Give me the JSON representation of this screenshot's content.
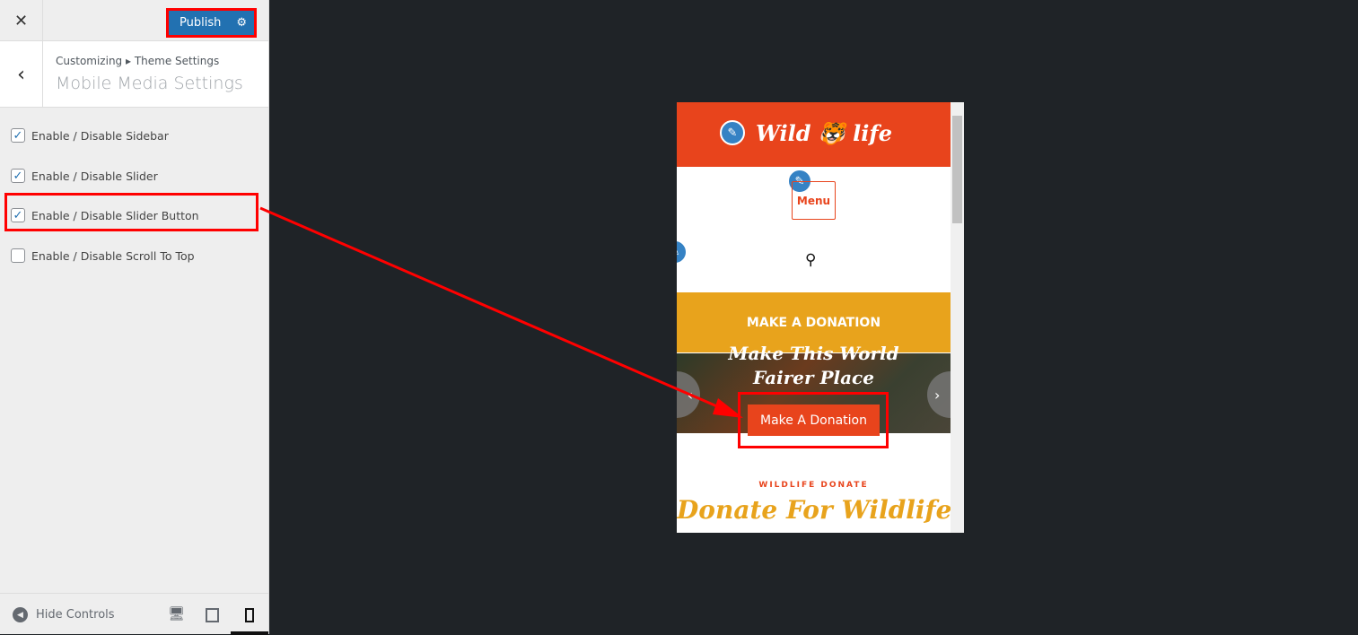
{
  "sidebar": {
    "publish_label": "Publish",
    "breadcrumb": "Customizing ▸ Theme Settings",
    "title": "Mobile Media Settings",
    "options": [
      {
        "label": "Enable / Disable Sidebar",
        "checked": true
      },
      {
        "label": "Enable / Disable Slider",
        "checked": true
      },
      {
        "label": "Enable / Disable Slider Button",
        "checked": true
      },
      {
        "label": "Enable / Disable Scroll To Top",
        "checked": false
      }
    ],
    "hide_controls": "Hide Controls"
  },
  "preview": {
    "logo": "Wild life",
    "menu": "Menu",
    "donation_bar": "MAKE A DONATION",
    "slider_line1": "Make This World",
    "slider_line2": "Fairer Place",
    "slider_button": "Make A Donation",
    "section_sub": "WILDLIFE DONATE",
    "section_title": "Donate For Wildlife"
  },
  "colors": {
    "accent": "#2271b1",
    "brand_orange": "#e8441c",
    "brand_yellow": "#e8a31c",
    "highlight": "#ff0000"
  }
}
